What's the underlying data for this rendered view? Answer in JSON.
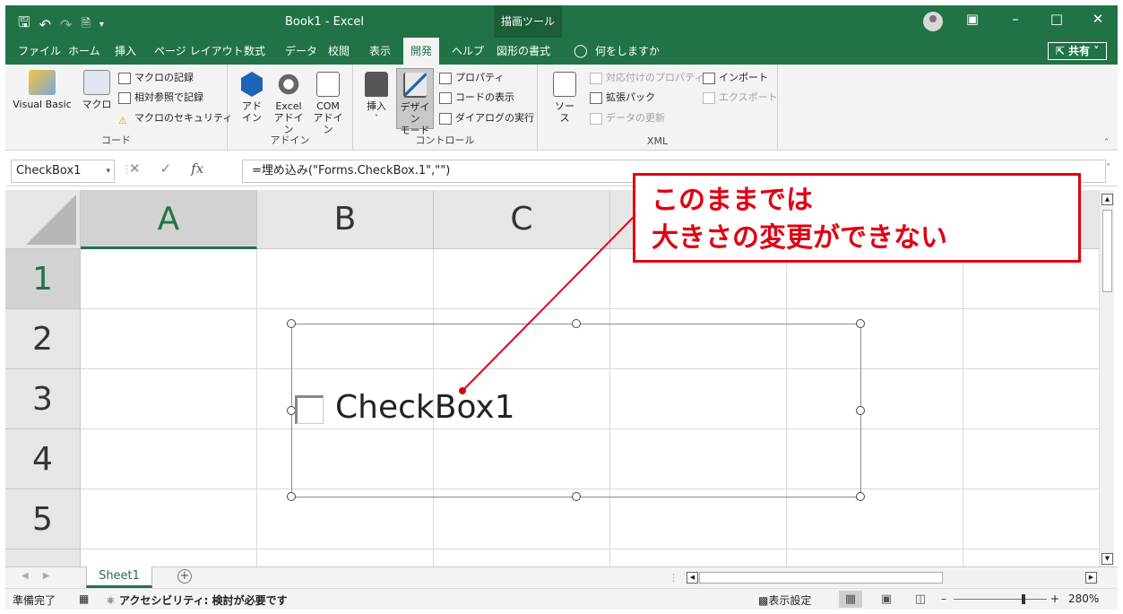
{
  "titlebar": {
    "title": "Book1  -  Excel",
    "context_tab": "描画ツール"
  },
  "tabs": [
    {
      "label": "ファイル"
    },
    {
      "label": "ホーム"
    },
    {
      "label": "挿入"
    },
    {
      "label": "ページ レイアウト"
    },
    {
      "label": "数式"
    },
    {
      "label": "データ"
    },
    {
      "label": "校閲"
    },
    {
      "label": "表示"
    },
    {
      "label": "開発",
      "active": true
    },
    {
      "label": "ヘルプ"
    },
    {
      "label": "図形の書式"
    },
    {
      "label": "何をしますか"
    }
  ],
  "share_label": "共有",
  "ribbon": {
    "code": {
      "label": "コード",
      "visual_basic": "Visual Basic",
      "macro": "マクロ",
      "record_macro": "マクロの記録",
      "relative_ref": "相対参照で記録",
      "macro_security": "マクロのセキュリティ"
    },
    "addins": {
      "label": "アドイン",
      "addin_line1": "アド",
      "addin_line2": "イン",
      "excel_line1": "Excel",
      "excel_line2": "アドイン",
      "com_line1": "COM",
      "com_line2": "アドイン"
    },
    "controls": {
      "label": "コントロール",
      "insert": "挿入",
      "design_line1": "デザイン",
      "design_line2": "モード",
      "properties": "プロパティ",
      "view_code": "コードの表示",
      "run_dialog": "ダイアログの実行"
    },
    "xml": {
      "label": "XML",
      "source": "ソース",
      "map_properties": "対応付けのプロパティ",
      "expansion_packs": "拡張パック",
      "refresh_data": "データの更新",
      "import": "インポート",
      "export": "エクスポート"
    }
  },
  "formula_bar": {
    "name_box": "CheckBox1",
    "fx": "fx",
    "formula": "=埋め込み(\"Forms.CheckBox.1\",\"\")"
  },
  "grid": {
    "columns": [
      "A",
      "B",
      "C"
    ],
    "rows": [
      "1",
      "2",
      "3",
      "4",
      "5"
    ]
  },
  "checkbox": {
    "label": "CheckBox1"
  },
  "callout": {
    "line1": "このままでは",
    "line2": "大きさの変更ができない"
  },
  "sheet_tab": "Sheet1",
  "status": {
    "ready": "準備完了",
    "accessibility": "アクセシビリティ: 検討が必要です",
    "display_settings": "表示設定",
    "zoom": "280%"
  },
  "colors": {
    "excel_green": "#217346",
    "callout_red": "#e00012"
  }
}
